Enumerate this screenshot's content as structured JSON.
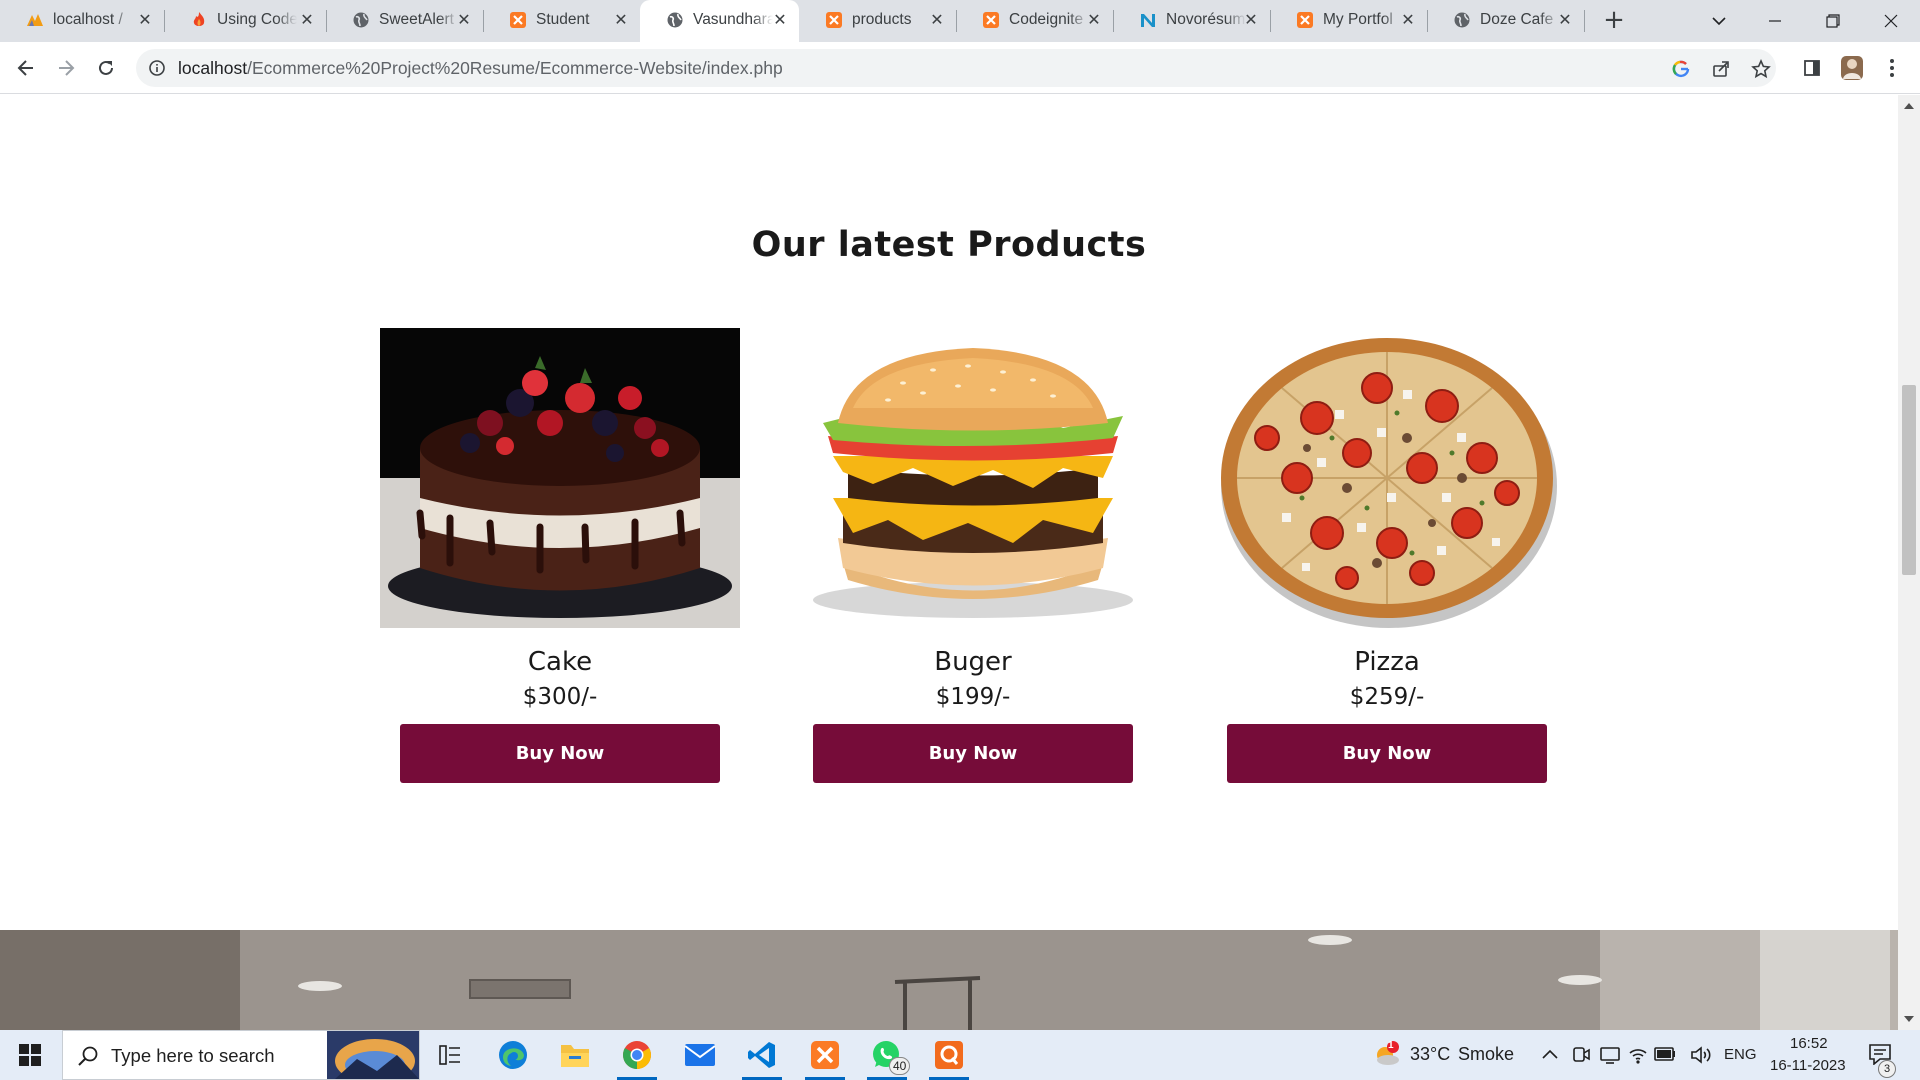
{
  "browser": {
    "tabs": [
      {
        "title": "localhost /",
        "icon": "phpmyadmin-icon",
        "active": false
      },
      {
        "title": "Using Code",
        "icon": "flame-icon",
        "active": false
      },
      {
        "title": "SweetAlert",
        "icon": "globe-icon",
        "active": false
      },
      {
        "title": "Student",
        "icon": "xampp-icon",
        "active": false
      },
      {
        "title": "Vasundhara",
        "icon": "globe-icon",
        "active": true
      },
      {
        "title": "products",
        "icon": "xampp-icon",
        "active": false
      },
      {
        "title": "Codeignite",
        "icon": "xampp-icon",
        "active": false
      },
      {
        "title": "Novorésumé",
        "icon": "novoresume-icon",
        "active": false
      },
      {
        "title": "My Portfol",
        "icon": "xampp-icon",
        "active": false
      },
      {
        "title": "Doze Cafe",
        "icon": "globe-icon",
        "active": false
      }
    ],
    "address": {
      "host": "localhost",
      "path": "/Ecommerce%20Project%20Resume/Ecommerce-Website/index.php"
    }
  },
  "page": {
    "section_title": "Our latest Products",
    "products": [
      {
        "name": "Cake",
        "price": "$300/-",
        "button": "Buy Now",
        "image": "chocolate-berry-cake"
      },
      {
        "name": "Buger",
        "price": "$199/-",
        "button": "Buy Now",
        "image": "double-cheeseburger"
      },
      {
        "name": "Pizza",
        "price": "$259/-",
        "button": "Buy Now",
        "image": "vegetable-pizza"
      }
    ],
    "accent_color": "#760c39"
  },
  "taskbar": {
    "search_placeholder": "Type here to search",
    "apps": [
      "task-view-icon",
      "edge-icon",
      "file-explorer-icon",
      "chrome-icon",
      "mail-icon",
      "vscode-icon",
      "xampp-icon",
      "whatsapp-icon",
      "qr-app-icon"
    ],
    "whatsapp_badge": "40",
    "weather": {
      "temp": "33°C",
      "condition": "Smoke",
      "alert": "1"
    },
    "language": "ENG",
    "time": "16:52",
    "date": "16-11-2023",
    "notifications": "3"
  }
}
